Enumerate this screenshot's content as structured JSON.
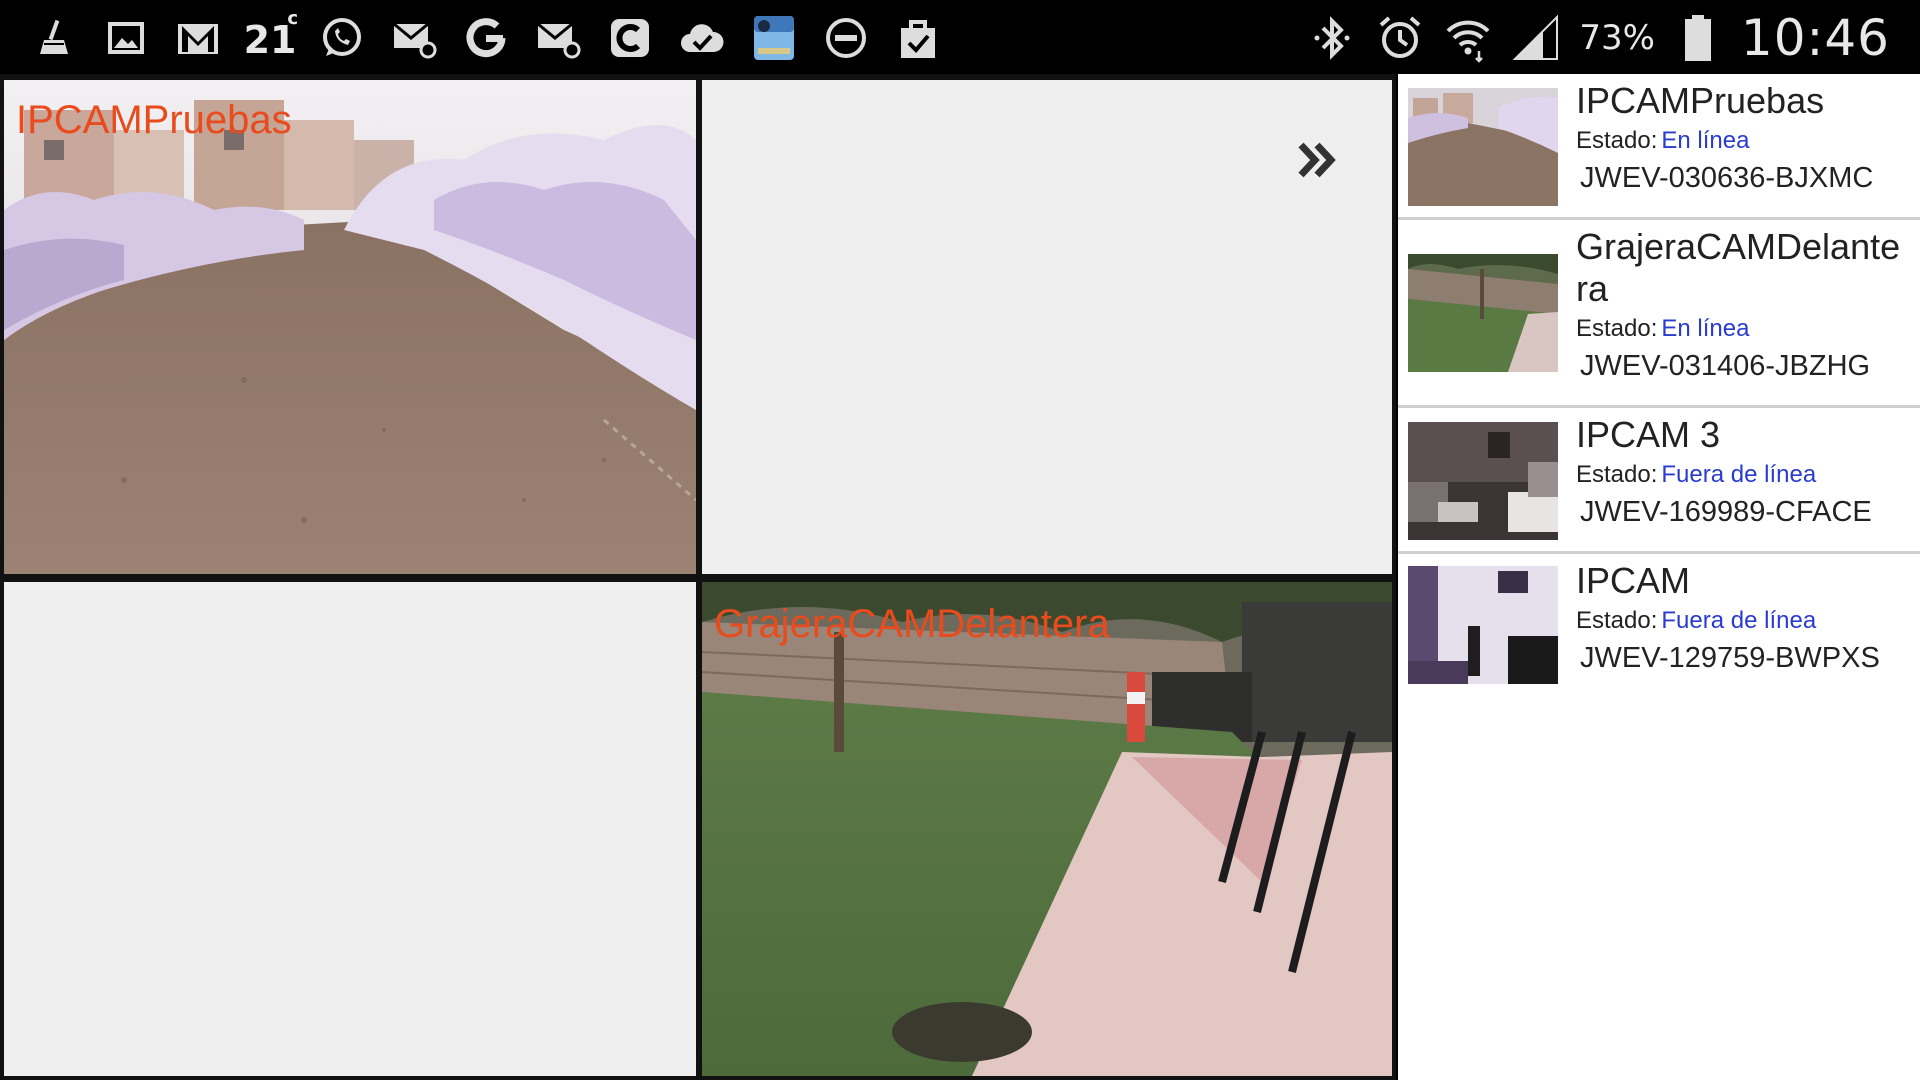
{
  "statusbar": {
    "left_icons": [
      "cleaner-icon",
      "gallery-icon",
      "gmail-icon",
      "weather-icon",
      "whatsapp-icon",
      "email-icon",
      "google-icon",
      "email-icon",
      "c-app-icon",
      "cloud-check-icon",
      "pnp-monitor-icon",
      "do-not-disturb-icon",
      "shopping-bag-check-icon"
    ],
    "temperature": "21",
    "temperature_unit": "c",
    "battery_percent": "73%",
    "time": "10:46"
  },
  "grid": {
    "tiles": [
      {
        "label": "IPCAMPruebas",
        "has_video": true
      },
      {
        "label": "",
        "has_video": false
      },
      {
        "label": "",
        "has_video": false
      },
      {
        "label": "GrajeraCAMDelantera",
        "has_video": true
      }
    ],
    "next_icon": "double-chevron-right-icon"
  },
  "devices": [
    {
      "name": "IPCAMPruebas",
      "status_label": "Estado:",
      "status_value": "En línea",
      "uid": "JWEV-030636-BJXMC"
    },
    {
      "name": "GrajeraCAMDelantera",
      "status_label": "Estado:",
      "status_value": "En línea",
      "uid": "JWEV-031406-JBZHG"
    },
    {
      "name": "IPCAM 3",
      "status_label": "Estado:",
      "status_value": "Fuera de línea",
      "uid": "JWEV-169989-CFACE"
    },
    {
      "name": "IPCAM",
      "status_label": "Estado:",
      "status_value": "Fuera de línea",
      "uid": "JWEV-129759-BWPXS"
    }
  ],
  "colors": {
    "camera_label": "#e94b1d",
    "status_value": "#2a3bd0",
    "empty_tile": "#efefef",
    "divider": "#cfcfcf"
  }
}
